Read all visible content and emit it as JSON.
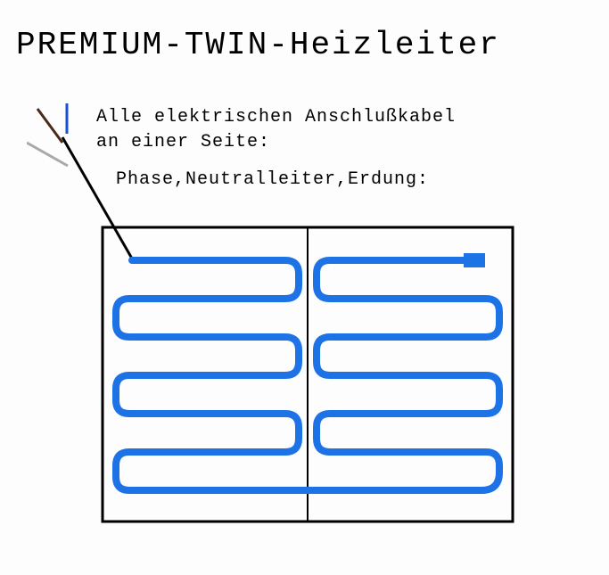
{
  "title": "PREMIUM-TWIN-Heizleiter",
  "caption_line1": "Alle elektrischen Anschlußkabel\nan einer Seite:",
  "caption_line2": "Phase,Neutralleiter,Erdung:",
  "diagram": {
    "type": "heating-cable-layout",
    "enclosure": "rectangular mat, two halves with center divider",
    "connection_side": "single-sided (top-left)",
    "lead_wires": [
      "brown (Phase)",
      "blue (Neutralleiter)",
      "grey (Erdung / PE)"
    ],
    "heating_cable_color": "#1d73e6",
    "terminator_shape": "rectangular end cap (top-right)"
  }
}
